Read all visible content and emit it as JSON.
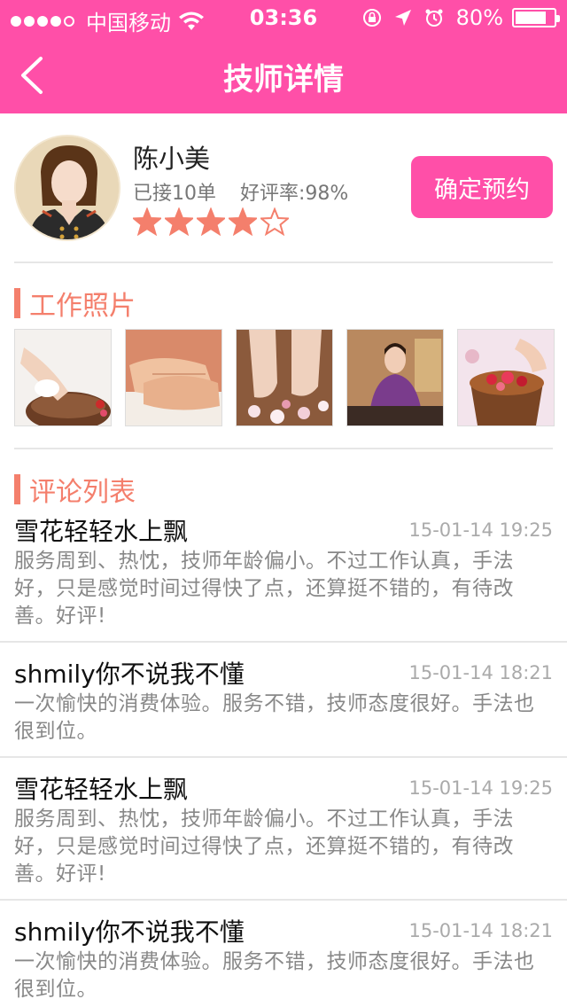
{
  "status_bar": {
    "carrier": "中国移动",
    "time": "03:36",
    "battery": "80%",
    "battery_level": 0.8
  },
  "nav": {
    "title": "技师详情",
    "back_icon": "chevron-left-icon"
  },
  "technician": {
    "name": "陈小美",
    "orders": "已接10单",
    "rating": "好评率:98%",
    "stars_filled": 4,
    "stars_total": 5,
    "book_label": "确定预约"
  },
  "photos_section": {
    "title": "工作照片",
    "photos": [
      "foot-soak-photo",
      "hand-massage-photo",
      "foot-petals-photo",
      "technician-photo",
      "rose-bath-photo"
    ]
  },
  "comments_section": {
    "title": "评论列表",
    "comments": [
      {
        "user": "雪花轻轻水上飘",
        "time": "15-01-14 19:25",
        "text": "服务周到、热忱，技师年龄偏小。不过工作认真，手法好，只是感觉时间过得快了点，还算挺不错的，有待改善。好评!"
      },
      {
        "user": "shmily你不说我不懂",
        "time": "15-01-14 18:21",
        "text": "一次愉快的消费体验。服务不错，技师态度很好。手法也很到位。"
      },
      {
        "user": "雪花轻轻水上飘",
        "time": "15-01-14 19:25",
        "text": "服务周到、热忱，技师年龄偏小。不过工作认真，手法好，只是感觉时间过得快了点，还算挺不错的，有待改善。好评!"
      },
      {
        "user": "shmily你不说我不懂",
        "time": "15-01-14 18:21",
        "text": "一次愉快的消费体验。服务不错，技师态度很好。手法也很到位。"
      }
    ]
  },
  "colors": {
    "brand": "#ff4fa8",
    "accent": "#f47f6c"
  }
}
